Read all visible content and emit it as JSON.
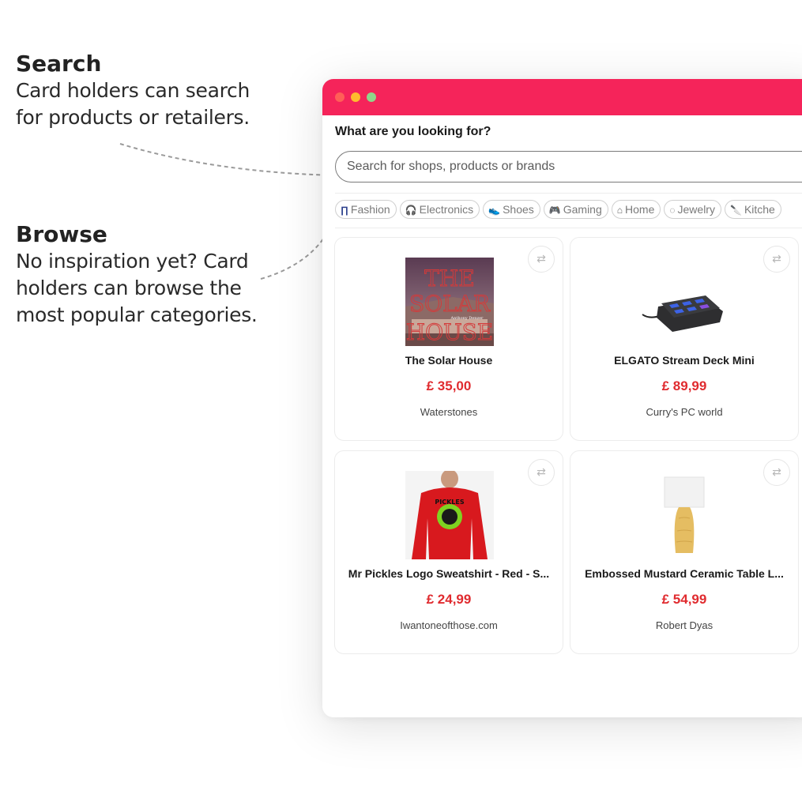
{
  "annotations": {
    "search": {
      "heading": "Search",
      "lines": [
        "Card holders can search",
        "for products or retailers."
      ]
    },
    "browse": {
      "heading": "Browse",
      "lines": [
        "No inspiration yet? Card",
        "holders can browse the",
        "most popular categories."
      ]
    }
  },
  "window": {
    "accent_color": "#f5245a",
    "question": "What are you looking for?",
    "search": {
      "placeholder": "Search for shops, products or brands",
      "value": ""
    },
    "categories": [
      {
        "label": "Fashion",
        "icon": "jeans-icon"
      },
      {
        "label": "Electronics",
        "icon": "headphones-icon"
      },
      {
        "label": "Shoes",
        "icon": "shoe-icon"
      },
      {
        "label": "Gaming",
        "icon": "gamepad-icon"
      },
      {
        "label": "Home",
        "icon": "house-icon"
      },
      {
        "label": "Jewelry",
        "icon": "ring-icon"
      },
      {
        "label": "Kitche",
        "icon": "knife-icon"
      }
    ],
    "products": [
      {
        "title": "The Solar House",
        "price": "£ 35,00",
        "shop": "Waterstones",
        "image": "book-cover",
        "image_text": [
          "THE",
          "SOLAR",
          "HOUSE",
          "Anthony Denzer"
        ]
      },
      {
        "title": "ELGATO Stream Deck Mini",
        "price": "£ 89,99",
        "shop": "Curry's PC world",
        "image": "stream-deck"
      },
      {
        "title": "Mr Pickles Logo Sweatshirt - Red - S...",
        "price": "£ 24,99",
        "shop": "Iwantoneofthose.com",
        "image": "red-sweatshirt",
        "image_text": [
          "PICKLES"
        ]
      },
      {
        "title": "Embossed Mustard Ceramic Table L...",
        "price": "£ 54,99",
        "shop": "Robert Dyas",
        "image": "table-lamp"
      }
    ],
    "price_color": "#e02b2f"
  }
}
